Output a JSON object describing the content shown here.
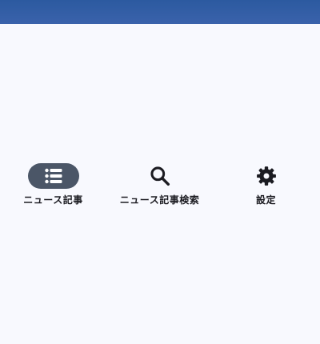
{
  "colors": {
    "top_bar": "#2c5aa0",
    "background": "#f8f9fe",
    "active_indicator": "#4b5667",
    "active_icon": "#ffffff",
    "icon": "#1b1b21",
    "label": "#1b1b21"
  },
  "bottom_nav": {
    "selected_index": 0,
    "items": [
      {
        "label": "ニュース記事",
        "icon": "list-icon",
        "active": true
      },
      {
        "label": "ニュース記事検索",
        "icon": "search-icon",
        "active": false
      },
      {
        "label": "設定",
        "icon": "gear-icon",
        "active": false
      }
    ]
  }
}
